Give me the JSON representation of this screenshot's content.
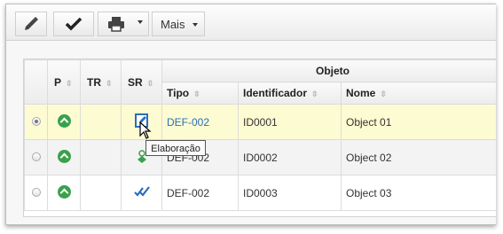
{
  "toolbar": {
    "mais_label": "Mais"
  },
  "table": {
    "group_header": "Objeto",
    "columns": {
      "p": "P",
      "tr": "TR",
      "sr": "SR",
      "tipo": "Tipo",
      "identificador": "Identificador",
      "nome": "Nome"
    },
    "rows": [
      {
        "tipo": "DEF-002",
        "identificador": "ID0001",
        "nome": "Object 01"
      },
      {
        "tipo": "DEF-002",
        "identificador": "ID0002",
        "nome": "Object 02"
      },
      {
        "tipo": "DEF-002",
        "identificador": "ID0003",
        "nome": "Object 03"
      }
    ]
  },
  "tooltip": {
    "text": "Elaboração"
  },
  "colors": {
    "priority_green": "#3aa14b",
    "link_blue": "#2a6ebb",
    "selected_row": "#fdfbd2"
  }
}
